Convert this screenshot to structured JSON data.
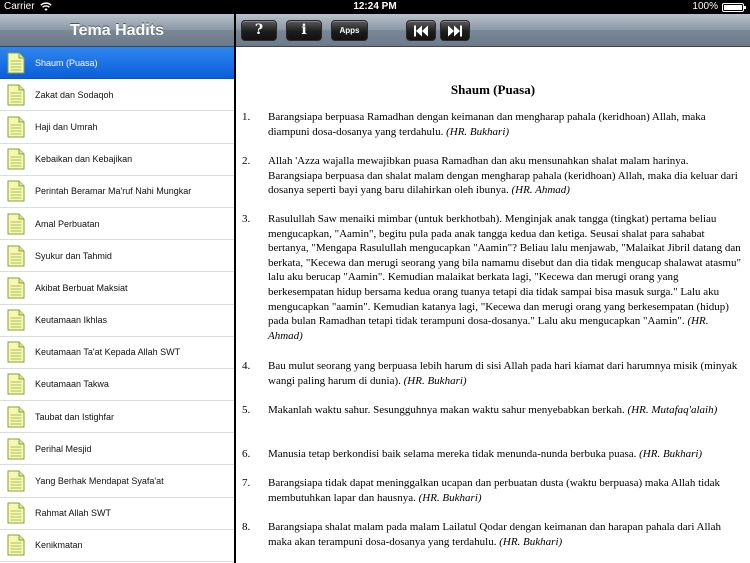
{
  "status_bar": {
    "carrier": "Carrier",
    "time": "12:24 PM",
    "battery": "100%"
  },
  "sidebar": {
    "title": "Tema Hadits",
    "items": [
      {
        "label": "Shaum (Puasa)"
      },
      {
        "label": "Zakat dan Sodaqoh"
      },
      {
        "label": "Haji dan Umrah"
      },
      {
        "label": "Kebaikan dan Kebajikan"
      },
      {
        "label": "Perintah Beramar Ma'ruf Nahi Mungkar"
      },
      {
        "label": "Amal Perbuatan"
      },
      {
        "label": "Syukur dan Tahmid"
      },
      {
        "label": "Akibat Berbuat Maksiat"
      },
      {
        "label": "Keutamaan Ikhlas"
      },
      {
        "label": "Keutamaan Ta'at Kepada Allah SWT"
      },
      {
        "label": "Keutamaan Takwa"
      },
      {
        "label": "Taubat dan Istighfar"
      },
      {
        "label": "Perihal Mesjid"
      },
      {
        "label": "Yang Berhak Mendapat Syafa'at"
      },
      {
        "label": "Rahmat Allah SWT"
      },
      {
        "label": "Kenikmatan"
      }
    ],
    "selected_label": "Shaum (Puasa)"
  },
  "toolbar": {
    "help_label": "?",
    "info_label": "i",
    "apps_label": "Apps",
    "prev_icon": "skip-back-icon",
    "next_icon": "skip-forward-icon"
  },
  "content": {
    "title": "Shaum (Puasa)",
    "hadiths": [
      {
        "num": "1.",
        "text": "Barangsiapa berpuasa Ramadhan dengan keimanan dan mengharap pahala (keridhoan) Allah, maka diampuni dosa-dosanya yang terdahulu.",
        "source": "(HR. Bukhari)"
      },
      {
        "num": "2.",
        "text": "Allah 'Azza wajalla mewajibkan puasa Ramadhan dan aku mensunahkan shalat malam harinya. Barangsiapa berpuasa dan shalat malam dengan mengharap pahala (keridhoan) Allah, maka dia keluar dari dosanya seperti bayi yang baru dilahirkan oleh ibunya.",
        "source": "(HR. Ahmad)"
      },
      {
        "num": "3.",
        "text": "Rasulullah Saw menaiki mimbar (untuk berkhotbah). Menginjak anak tangga (tingkat) pertama beliau mengucapkan, \"Aamin\", begitu pula pada anak tangga kedua dan ketiga. Seusai shalat para sahabat bertanya, \"Mengapa Rasulullah mengucapkan \"Aamin\"? Beliau lalu menjawab, \"Malaikat Jibril datang dan berkata, \"Kecewa dan merugi seorang yang bila namamu disebut dan dia tidak mengucap shalawat atasmu\" lalu aku berucap \"Aamin\". Kemudian malaikat berkata lagi, \"Kecewa dan merugi orang yang berkesempatan hidup bersama kedua orang tuanya tetapi dia tidak sampai bisa masuk surga.\" Lalu aku mengucapkan \"aamin\". Kemudian katanya lagi, \"Kecewa dan merugi orang yang berkesempatan (hidup) pada bulan Ramadhan tetapi tidak terampuni dosa-dosanya.\" Lalu aku mengucapkan \"Aamin\".",
        "source": "(HR. Ahmad)"
      },
      {
        "num": "4.",
        "text": "Bau mulut seorang yang berpuasa lebih harum di sisi Allah pada hari kiamat dari harumnya misik (minyak wangi paling harum di dunia).",
        "source": "(HR. Bukhari)"
      },
      {
        "num": "5.",
        "text": "Makanlah waktu sahur. Sesungguhnya makan waktu sahur menyebabkan berkah.",
        "source": "(HR. Mutafaq'alaih)"
      },
      {
        "num": "6.",
        "text": "Manusia tetap berkondisi baik selama mereka tidak menunda-nunda berbuka puasa.",
        "source": "(HR. Bukhari)"
      },
      {
        "num": "7.",
        "text": "Barangsiapa tidak dapat meninggalkan ucapan dan perbuatan dusta (waktu berpuasa) maka Allah tidak membutuhkan lapar dan hausnya.",
        "source": "(HR. Bukhari)"
      },
      {
        "num": "8.",
        "text": "Barangsiapa shalat malam pada malam Lailatul Qodar dengan keimanan dan harapan pahala dari Allah maka akan terampuni dosa-dosanya yang terdahulu.",
        "source": "(HR. Bukhari)"
      }
    ]
  },
  "colors": {
    "selection": "#1a6ee6",
    "toolbar": "#8b97a5"
  }
}
